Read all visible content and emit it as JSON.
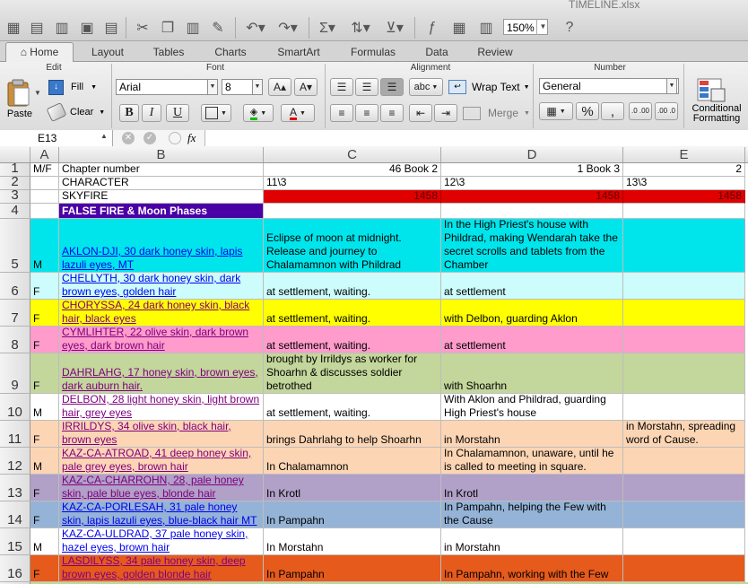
{
  "window": {
    "file_name": "TIMELINE.xlsx",
    "zoom": "150%"
  },
  "ribbon_tabs": [
    "Home",
    "Layout",
    "Tables",
    "Charts",
    "SmartArt",
    "Formulas",
    "Data",
    "Review"
  ],
  "ribbon": {
    "groups": {
      "edit": "Edit",
      "font": "Font",
      "alignment": "Alignment",
      "number": "Number"
    },
    "paste_label": "Paste",
    "fill_label": "Fill",
    "clear_label": "Clear",
    "font_name": "Arial",
    "font_size": "8",
    "bold": "B",
    "italic": "I",
    "underline": "U",
    "wrap_text_prefix": "abc",
    "wrap_text_label": "Wrap Text",
    "merge_label": "Merge",
    "number_format": "General",
    "percent": "%",
    "comma": ",",
    "increase_decimal": ".0 .00",
    "decrease_decimal": ".00 .0",
    "conditional_formatting": "Conditional Formatting"
  },
  "formula_bar": {
    "cell_ref": "E13",
    "fx": "fx",
    "value": ""
  },
  "columns": [
    "A",
    "B",
    "C",
    "D",
    "E"
  ],
  "colors": {
    "red": "#e00000",
    "purple": "#4b00a6",
    "cyan": "#00e5ec",
    "pale_cyan": "#ccfcfc",
    "yellow": "#ffff00",
    "pink": "#ff9ccb",
    "olive": "#c3d69b",
    "peach": "#fcd5b4",
    "lavender": "#b1a0c7",
    "blue": "#95b3d7",
    "orange": "#e65a1c",
    "link_blue": "#0000ee",
    "link_purple": "#800080"
  },
  "rows": [
    {
      "num": "1",
      "a": "M/F",
      "b": "Chapter number",
      "c": "46 Book 2",
      "d": "1 Book 3",
      "e": "2"
    },
    {
      "num": "2",
      "a": "",
      "b": "CHARACTER",
      "c": "11\\3",
      "d": "12\\3",
      "e": "13\\3"
    },
    {
      "num": "3",
      "a": "",
      "b": "SKYFIRE",
      "c": "1458",
      "d": "1458",
      "e": "1458"
    },
    {
      "num": "4",
      "a": "",
      "b": "FALSE FIRE    & Moon Phases",
      "c": "",
      "d": "",
      "e": ""
    },
    {
      "num": "5",
      "a": "M",
      "b": "AKLON-DJI, 30 dark honey skin, lapis lazuli eyes, MT",
      "c": "Eclipse of moon at midnight. Release and journey to Chalamamnon with Phildrad",
      "d": "In the High Priest's house with Phildrad, making Wendarah take the secret scrolls and tablets from the Chamber",
      "e": ""
    },
    {
      "num": "6",
      "a": "F",
      "b": "CHELLYTH, 30 dark honey skin, dark brown eyes, golden hair",
      "c": "at settlement, waiting.",
      "d": "at settlement",
      "e": ""
    },
    {
      "num": "7",
      "a": "F",
      "b": "CHORYSSA, 24 dark honey skin, black hair, black eyes",
      "c": "at settlement, waiting.",
      "d": "with Delbon, guarding Aklon",
      "e": ""
    },
    {
      "num": "8",
      "a": "F",
      "b": "CYMLIHTER, 22 olive skin, dark brown eyes, dark brown hair",
      "c": "at settlement, waiting.",
      "d": "at settlement",
      "e": ""
    },
    {
      "num": "9",
      "a": "F",
      "b": "DAHRLAHG, 17 honey skin, brown eyes, dark auburn hair.",
      "c": "brought by Irrildys as worker for Shoarhn & discusses soldier betrothed",
      "d": "with Shoarhn",
      "e": ""
    },
    {
      "num": "10",
      "a": "M",
      "b": "DELBON, 28 light honey skin, light brown hair, grey eyes",
      "c": "at settlement, waiting.",
      "d": "With Aklon and Phildrad, guarding High Priest's house",
      "e": ""
    },
    {
      "num": "11",
      "a": "F",
      "b": "IRRILDYS, 34 olive skin, black hair, brown eyes",
      "c": "brings Dahrlahg to help Shoarhn",
      "d": "in Morstahn",
      "e": "in Morstahn, spreading word of Cause."
    },
    {
      "num": "12",
      "a": "M",
      "b": "KAZ-CA-ATROAD, 41 deep honey skin, pale grey eyes, brown hair",
      "c": "In Chalamamnon",
      "d": "In Chalamamnon, unaware, until he is called to meeting in square.",
      "e": ""
    },
    {
      "num": "13",
      "a": "F",
      "b": "KAZ-CA-CHARROHN, 28, pale honey skin, pale blue eyes, blonde hair",
      "c": "In Krotl",
      "d": "In Krotl",
      "e": ""
    },
    {
      "num": "14",
      "a": "F",
      "b": "KAZ-CA-PORLESAH, 31 pale honey skin, lapis lazuli eyes, blue-black hair MT",
      "c": "In Pampahn",
      "d": "In Pampahn, helping the Few with the Cause",
      "e": ""
    },
    {
      "num": "15",
      "a": "M",
      "b": "KAZ-CA-ULDRAD, 37 pale honey skin, hazel eyes, brown hair",
      "c": "In Morstahn",
      "d": "in Morstahn",
      "e": ""
    },
    {
      "num": "16",
      "a": "F",
      "b": "LASDILYSS, 34 pale honey skin, deep brown eyes, golden blonde hair",
      "c": "In Pampahn",
      "d": "In Pampahn, working with the Few",
      "e": ""
    }
  ]
}
